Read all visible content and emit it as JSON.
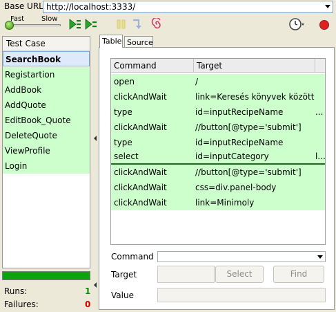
{
  "base_url": {
    "label": "Base URL",
    "value": "http://localhost:3333/"
  },
  "speed": {
    "fast_label": "Fast",
    "slow_label": "Slow"
  },
  "toolbar_icons": [
    "play-suite-icon",
    "play-test-icon",
    "pause-icon",
    "step-icon",
    "rollup-icon",
    "schedule-clock-icon",
    "record-icon"
  ],
  "colors": {
    "pass_green": "#ccffcc",
    "progress_green": "#0ea30e",
    "runs_green": "#0a8a0a",
    "failure_red": "#d00000",
    "record_red": "#dd2222"
  },
  "test_cases": {
    "header": "Test Case",
    "items": [
      {
        "label": "SearchBook",
        "selected": true
      },
      {
        "label": "Registartion"
      },
      {
        "label": "AddBook"
      },
      {
        "label": "AddQuote"
      },
      {
        "label": "EditBook_Quote"
      },
      {
        "label": "DeleteQuote"
      },
      {
        "label": "ViewProfile"
      },
      {
        "label": "Login"
      }
    ]
  },
  "progress": {
    "fraction": 1.0
  },
  "stats": {
    "runs_label": "Runs:",
    "runs": "1",
    "failures_label": "Failures:",
    "failures": "0"
  },
  "tabs": {
    "table": "Table",
    "source": "Source"
  },
  "table": {
    "headers": {
      "command": "Command",
      "target": "Target"
    },
    "rows": [
      {
        "command": "open",
        "target": "/",
        "value": ""
      },
      {
        "command": "clickAndWait",
        "target": "link=Keresés könyvek között",
        "value": ""
      },
      {
        "command": "type",
        "target": "id=inputRecipeName",
        "value": "..."
      },
      {
        "command": "clickAndWait",
        "target": "//button[@type='submit']",
        "value": ""
      },
      {
        "command": "type",
        "target": "id=inputRecipeName",
        "value": ""
      },
      {
        "command": "select",
        "target": "id=inputCategory",
        "value": "l..."
      },
      {
        "command": "clickAndWait",
        "target": "//button[@type='submit']",
        "value": ""
      },
      {
        "command": "clickAndWait",
        "target": "css=div.panel-body",
        "value": ""
      },
      {
        "command": "clickAndWait",
        "target": "link=Minimoly",
        "value": ""
      }
    ]
  },
  "form": {
    "command_label": "Command",
    "target_label": "Target",
    "value_label": "Value",
    "select_button": "Select",
    "find_button": "Find"
  }
}
